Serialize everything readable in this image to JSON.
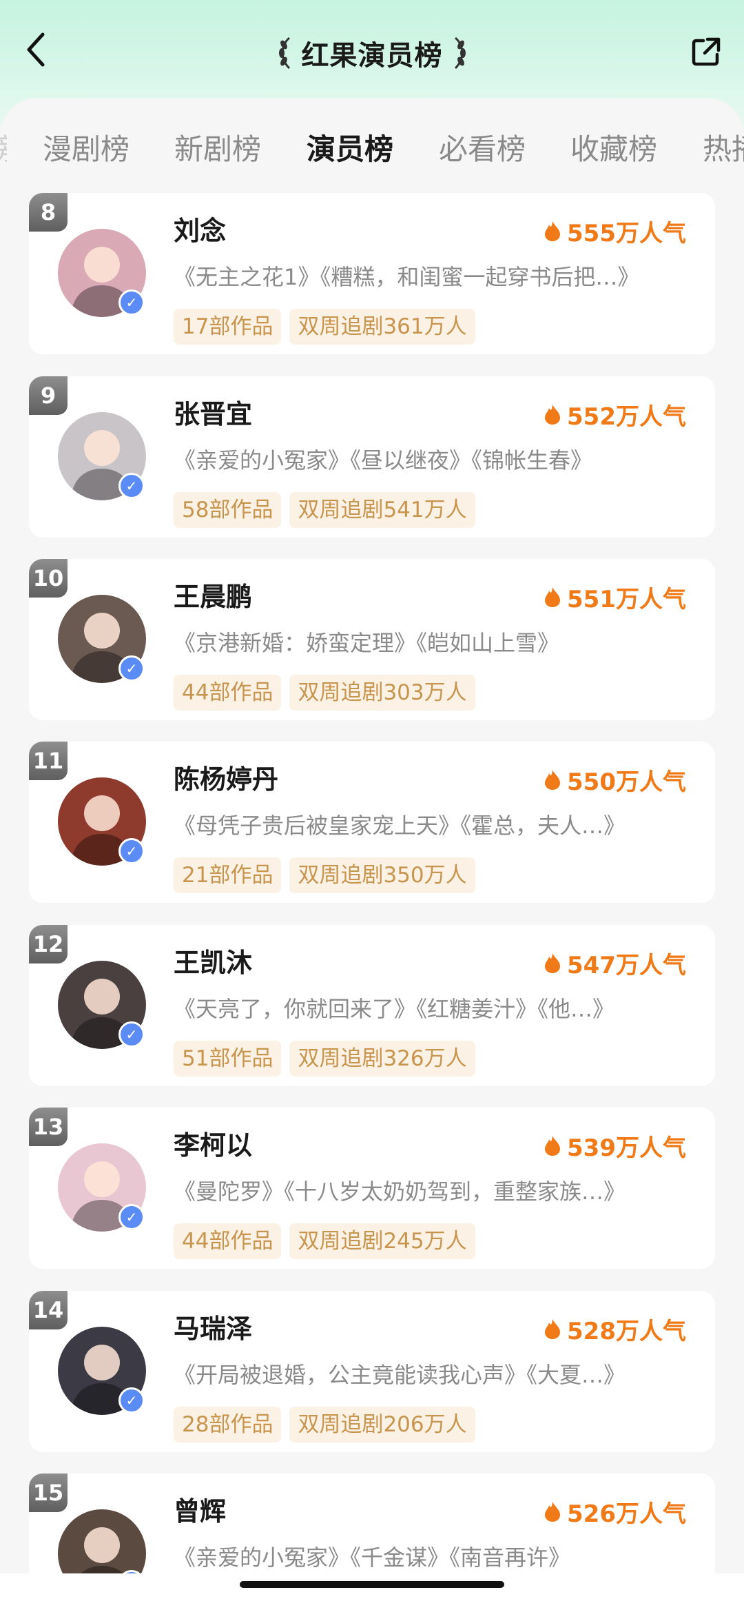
{
  "header": {
    "title": "红果演员榜",
    "back_icon": "chevron-left-icon",
    "share_icon": "share-icon"
  },
  "tabs": [
    {
      "label": "漫剧榜",
      "active": false
    },
    {
      "label": "新剧榜",
      "active": false
    },
    {
      "label": "演员榜",
      "active": true
    },
    {
      "label": "必看榜",
      "active": false
    },
    {
      "label": "收藏榜",
      "active": false
    },
    {
      "label": "热播榜",
      "active": false
    }
  ],
  "colors": {
    "accent_orange": "#f07a17",
    "tag_bg": "#fbf1e4",
    "tag_text": "#c8954f",
    "verify_blue": "#5b8cf5"
  },
  "actors": [
    {
      "rank": "8",
      "name": "刘念",
      "popularity": "555万人气",
      "works": "《无主之花1》《糟糕，和闺蜜一起穿书后把…》",
      "count": "17部作品",
      "followers": "双周追剧361万人",
      "avatar_color": "#d9a9b5"
    },
    {
      "rank": "9",
      "name": "张晋宜",
      "popularity": "552万人气",
      "works": "《亲爱的小冤家》《昼以继夜》《锦帐生春》",
      "count": "58部作品",
      "followers": "双周追剧541万人",
      "avatar_color": "#c9c4c8"
    },
    {
      "rank": "10",
      "name": "王晨鹏",
      "popularity": "551万人气",
      "works": "《京港新婚：娇蛮定理》《皑如山上雪》",
      "count": "44部作品",
      "followers": "双周追剧303万人",
      "avatar_color": "#6b5a52"
    },
    {
      "rank": "11",
      "name": "陈杨婷丹",
      "popularity": "550万人气",
      "works": "《母凭子贵后被皇家宠上天》《霍总，夫人…》",
      "count": "21部作品",
      "followers": "双周追剧350万人",
      "avatar_color": "#8e3a2c"
    },
    {
      "rank": "12",
      "name": "王凯沐",
      "popularity": "547万人气",
      "works": "《天亮了，你就回来了》《红糖姜汁》《他…》",
      "count": "51部作品",
      "followers": "双周追剧326万人",
      "avatar_color": "#4a4040"
    },
    {
      "rank": "13",
      "name": "李柯以",
      "popularity": "539万人气",
      "works": "《曼陀罗》《十八岁太奶奶驾到，重整家族…》",
      "count": "44部作品",
      "followers": "双周追剧245万人",
      "avatar_color": "#e8c6d2"
    },
    {
      "rank": "14",
      "name": "马瑞泽",
      "popularity": "528万人气",
      "works": "《开局被退婚，公主竟能读我心声》《大夏…》",
      "count": "28部作品",
      "followers": "双周追剧206万人",
      "avatar_color": "#3c3a44"
    },
    {
      "rank": "15",
      "name": "曾辉",
      "popularity": "526万人气",
      "works": "《亲爱的小冤家》《千金谋》《南音再许》",
      "count": "",
      "followers": "",
      "avatar_color": "#5a4a40"
    }
  ]
}
